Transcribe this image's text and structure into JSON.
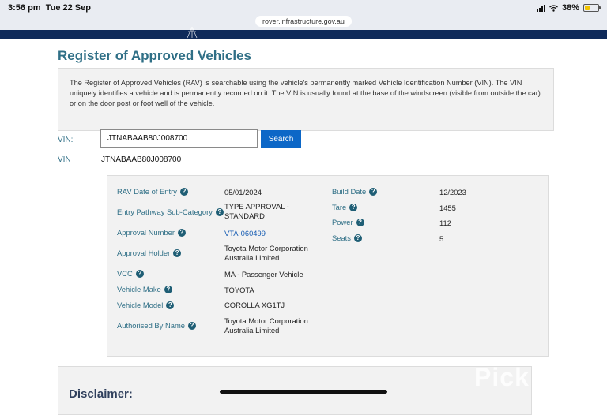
{
  "status_bar": {
    "time": "3:56 pm",
    "date": "Tue 22 Sep",
    "battery": "38%",
    "battery_level": 0.38
  },
  "browser": {
    "url": "rover.infrastructure.gov.au"
  },
  "page": {
    "title": "Register of Approved Vehicles",
    "intro": "The Register of Approved Vehicles (RAV) is searchable using the vehicle's permanently marked Vehicle Identification Number (VIN). The VIN uniquely identifies a vehicle and is permanently recorded on it. The VIN is usually found at the base of the windscreen (visible from outside the car) or on the door post or foot well of the vehicle."
  },
  "search": {
    "label": "VIN:",
    "value": "JTNABAAB80J008700",
    "button_label": "Search"
  },
  "result": {
    "vin_label": "VIN",
    "vin_value": "JTNABAAB80J008700"
  },
  "details": {
    "rav_date": {
      "label": "RAV Date of Entry",
      "value": "05/01/2024"
    },
    "entry_pathway": {
      "label": "Entry Pathway Sub-Category",
      "value": "TYPE APPROVAL - STANDARD"
    },
    "approval_number": {
      "label": "Approval Number",
      "value": "VTA-060499"
    },
    "approval_holder": {
      "label": "Approval Holder",
      "value": "Toyota Motor Corporation Australia Limited"
    },
    "vcc": {
      "label": "VCC",
      "value": "MA - Passenger Vehicle"
    },
    "make": {
      "label": "Vehicle Make",
      "value": "TOYOTA"
    },
    "model": {
      "label": "Vehicle Model",
      "value": "COROLLA XG1TJ"
    },
    "authorised_by": {
      "label": "Authorised By Name",
      "value": "Toyota Motor Corporation Australia Limited"
    },
    "build_date": {
      "label": "Build Date",
      "value": "12/2023"
    },
    "tare": {
      "label": "Tare",
      "value": "1455"
    },
    "power": {
      "label": "Power",
      "value": "112"
    },
    "seats": {
      "label": "Seats",
      "value": "5"
    }
  },
  "help_icon_glyph": "?",
  "disclaimer": {
    "title": "Disclaimer:"
  },
  "watermark": "Pick",
  "colors": {
    "title": "#2f6f86",
    "nav_band": "#0f2a5a",
    "search_button": "#0c67c7",
    "link": "#1a5fb4"
  }
}
